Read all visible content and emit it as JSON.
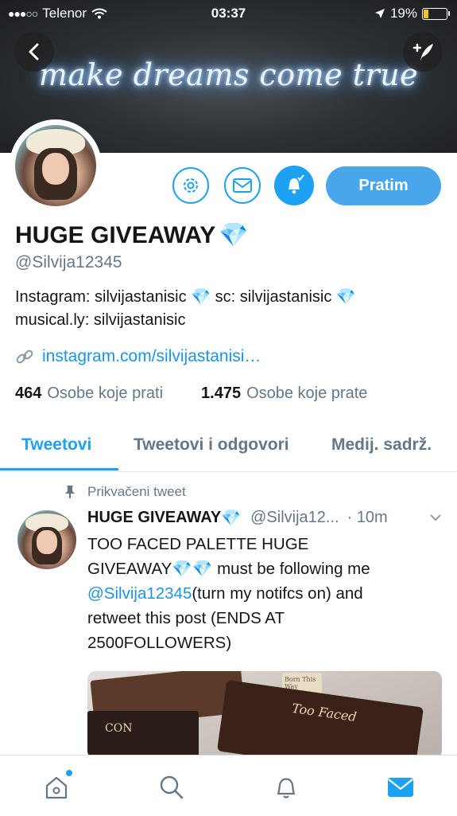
{
  "status_bar": {
    "carrier": "Telenor",
    "time": "03:37",
    "battery": "19%",
    "battery_level": 0.19
  },
  "header": {
    "banner_text": "make dreams come true"
  },
  "profile": {
    "follow_label": "Pratim",
    "name": "HUGE GIVEAWAY",
    "handle": "@Silvija12345",
    "bio_line1_a": "Instagram: silvijastanisic",
    "bio_line1_b": "sc: silvijastanisic",
    "bio_line2": "musical.ly: silvijastanisic",
    "link": "instagram.com/silvijastanisi…",
    "following_count": "464",
    "following_label": "Osobe koje prati",
    "followers_count": "1.475",
    "followers_label": "Osobe koje prate"
  },
  "tabs": [
    "Tweetovi",
    "Tweetovi i odgovori",
    "Medij. sadrž."
  ],
  "tweet": {
    "pinned_label": "Prikvačeni tweet",
    "author": "HUGE GIVEAWAY",
    "handle": "@Silvija12...",
    "time": "· 10m",
    "text_1": "TOO FACED PALETTE HUGE",
    "text_2a": "GIVEAWAY",
    "text_2b": " must be following me",
    "mention": "@Silvija12345",
    "text_3b": "(turn my notifcs on) and",
    "text_4": "retweet this post (ENDS AT",
    "text_5": "2500FOLLOWERS)",
    "media_text_a": "Too Faced",
    "media_text_b": "Born This Way",
    "media_text_c": "CON"
  },
  "icons": [
    "back-icon",
    "compose-icon",
    "gear-icon",
    "mail-icon",
    "bell-icon",
    "link-icon",
    "pin-icon",
    "chevron-down-icon",
    "home-icon",
    "search-icon",
    "notifications-icon",
    "messages-icon"
  ],
  "colors": {
    "accent": "#1da1f2",
    "muted": "#657786"
  }
}
